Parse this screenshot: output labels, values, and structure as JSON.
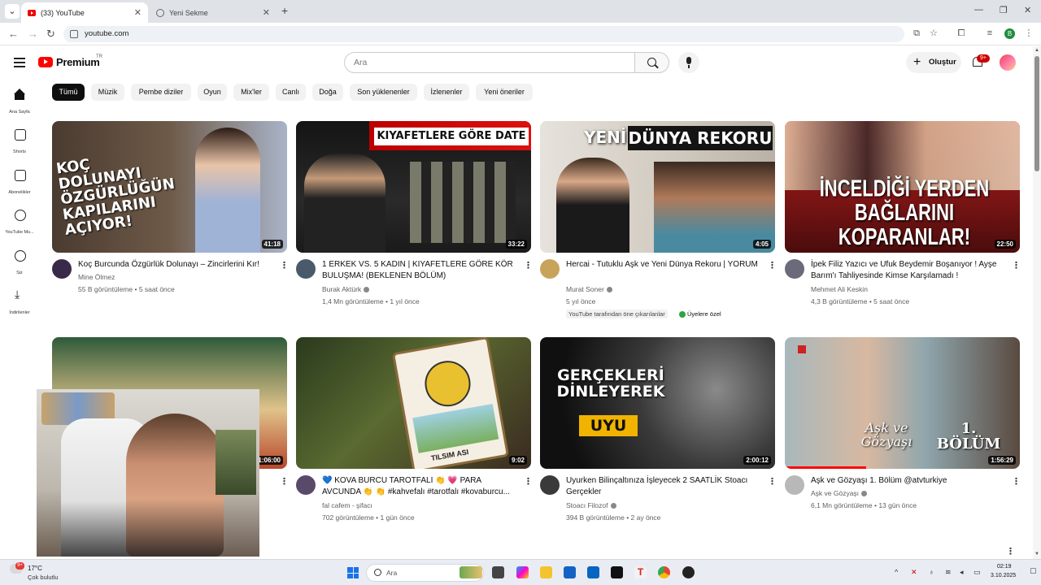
{
  "browser": {
    "tabs": [
      {
        "title": "(33) YouTube",
        "active": true
      },
      {
        "title": "Yeni Sekme",
        "active": false
      }
    ],
    "url": "youtube.com",
    "profile_initial": "B"
  },
  "header": {
    "logo_text": "Premium",
    "logo_region": "TR",
    "search_placeholder": "Ara",
    "create_label": "Oluştur",
    "notifications_badge": "9+"
  },
  "rail": [
    {
      "label": "Ana Sayfa",
      "icon": "home-icon"
    },
    {
      "label": "Shorts",
      "icon": "shorts-icon"
    },
    {
      "label": "Abonelikler",
      "icon": "subscriptions-icon"
    },
    {
      "label": "YouTube Mu...",
      "icon": "youtube-music-icon"
    },
    {
      "label": "Siz",
      "icon": "you-icon"
    },
    {
      "label": "İndirilenler",
      "icon": "download-icon"
    }
  ],
  "chips": [
    "Tümü",
    "Müzik",
    "Pembe diziler",
    "Oyun",
    "Mix'ler",
    "Canlı",
    "Doğa",
    "Son yüklenenler",
    "İzlenenler",
    "Yeni öneriler"
  ],
  "videos": [
    {
      "thumb_text": "KOÇ DOLUNAYI ÖZGÜRLÜĞÜN KAPILARINI AÇIYOR!",
      "duration": "41:18",
      "title": "Koç Burcunda Özgürlük Dolunayı – Zincirlerini Kır!",
      "channel": "Mine Ölmez",
      "views": "55 B görüntüleme",
      "age": "5 saat önce",
      "thumb_color": "#5b4a3e",
      "avatar_color": "#3a2a4a"
    },
    {
      "thumb_text": "KIYAFETLERE GÖRE DATE",
      "duration": "33:22",
      "title": "1 ERKEK VS. 5 KADIN | KIYAFETLERE GÖRE KÖR BULUŞMA! (BEKLENEN BÖLÜM)",
      "channel": "Burak Aktürk",
      "views": "1,4 Mn görüntüleme",
      "age": "1 yıl önce",
      "thumb_color": "#2a2a2a",
      "avatar_color": "#4a5a6a"
    },
    {
      "thumb_text_a": "YENİ",
      "thumb_text_b": "DÜNYA REKORU",
      "duration": "4:05",
      "title": "Hercai - Tutuklu Aşk ve Yeni Dünya Rekoru | YORUM",
      "channel": "Murat Soner",
      "views": "5 yıl önce",
      "badge_featured": "YouTube tarafından öne çıkarılanlar",
      "badge_members": "Üyelere özel",
      "thumb_color": "#c9c4bc",
      "avatar_color": "#c8a35a"
    },
    {
      "thumb_text": "İNCELDİĞİ YERDEN BAĞLARINI KOPARANLAR!",
      "duration": "22:50",
      "title": "İpek Filiz Yazıcı ve Ufuk Beydemir Boşanıyor ! Ayşe Barım'ı Tahliyesinde Kimse Karşılamadı !",
      "channel": "Mehmet Ali Keskin",
      "views": "4,3 B görüntüleme",
      "age": "5 saat önce",
      "thumb_color": "#8a1f1f",
      "avatar_color": "#6a6a7a"
    },
    {
      "duration": "1:06:00",
      "thumb_color": "#2f5a3a"
    },
    {
      "thumb_text": "TILSIM ASI",
      "duration": "9:02",
      "title": "💙 KOVA BURCU TAROTFALI 👏 💗 PARA AVCUNDA 👏 👏 #kahvefalı #tarotfalı #kovaburcu...",
      "channel": "fal cafem - şifacı",
      "views": "702 görüntüleme",
      "age": "1 gün önce",
      "thumb_color": "#3d4a2a",
      "avatar_color": "#5a4a6a"
    },
    {
      "thumb_text_a": "GERÇEKLERİ DİNLEYEREK",
      "thumb_text_b": "UYU",
      "duration": "2:00:12",
      "title": "Uyurken Bilinçaltınıza İşleyecek 2 SAATLİK Stoacı Gerçekler",
      "channel": "Stoacı Filozof",
      "views": "394 B görüntüleme",
      "age": "2 ay önce",
      "thumb_color": "#1a1a1a",
      "avatar_color": "#3a3a3a"
    },
    {
      "thumb_text_a": "Aşk ve Gözyaşı",
      "thumb_text_b": "1. BÖLÜM",
      "duration": "1:56:29",
      "title": "Aşk ve Gözyaşı 1. Bölüm @atvturkiye",
      "channel": "Aşk ve Gözyaşı",
      "views": "6,1 Mn görüntüleme",
      "age": "13 gün önce",
      "thumb_color": "#8fa6ad",
      "avatar_color": "#b8b8b8"
    }
  ],
  "taskbar": {
    "weather_temp": "17°C",
    "weather_desc": "Çok bulutlu",
    "weather_badge": "9+",
    "search_placeholder": "Ara",
    "time": "02:19",
    "date": "3.10.2025"
  }
}
